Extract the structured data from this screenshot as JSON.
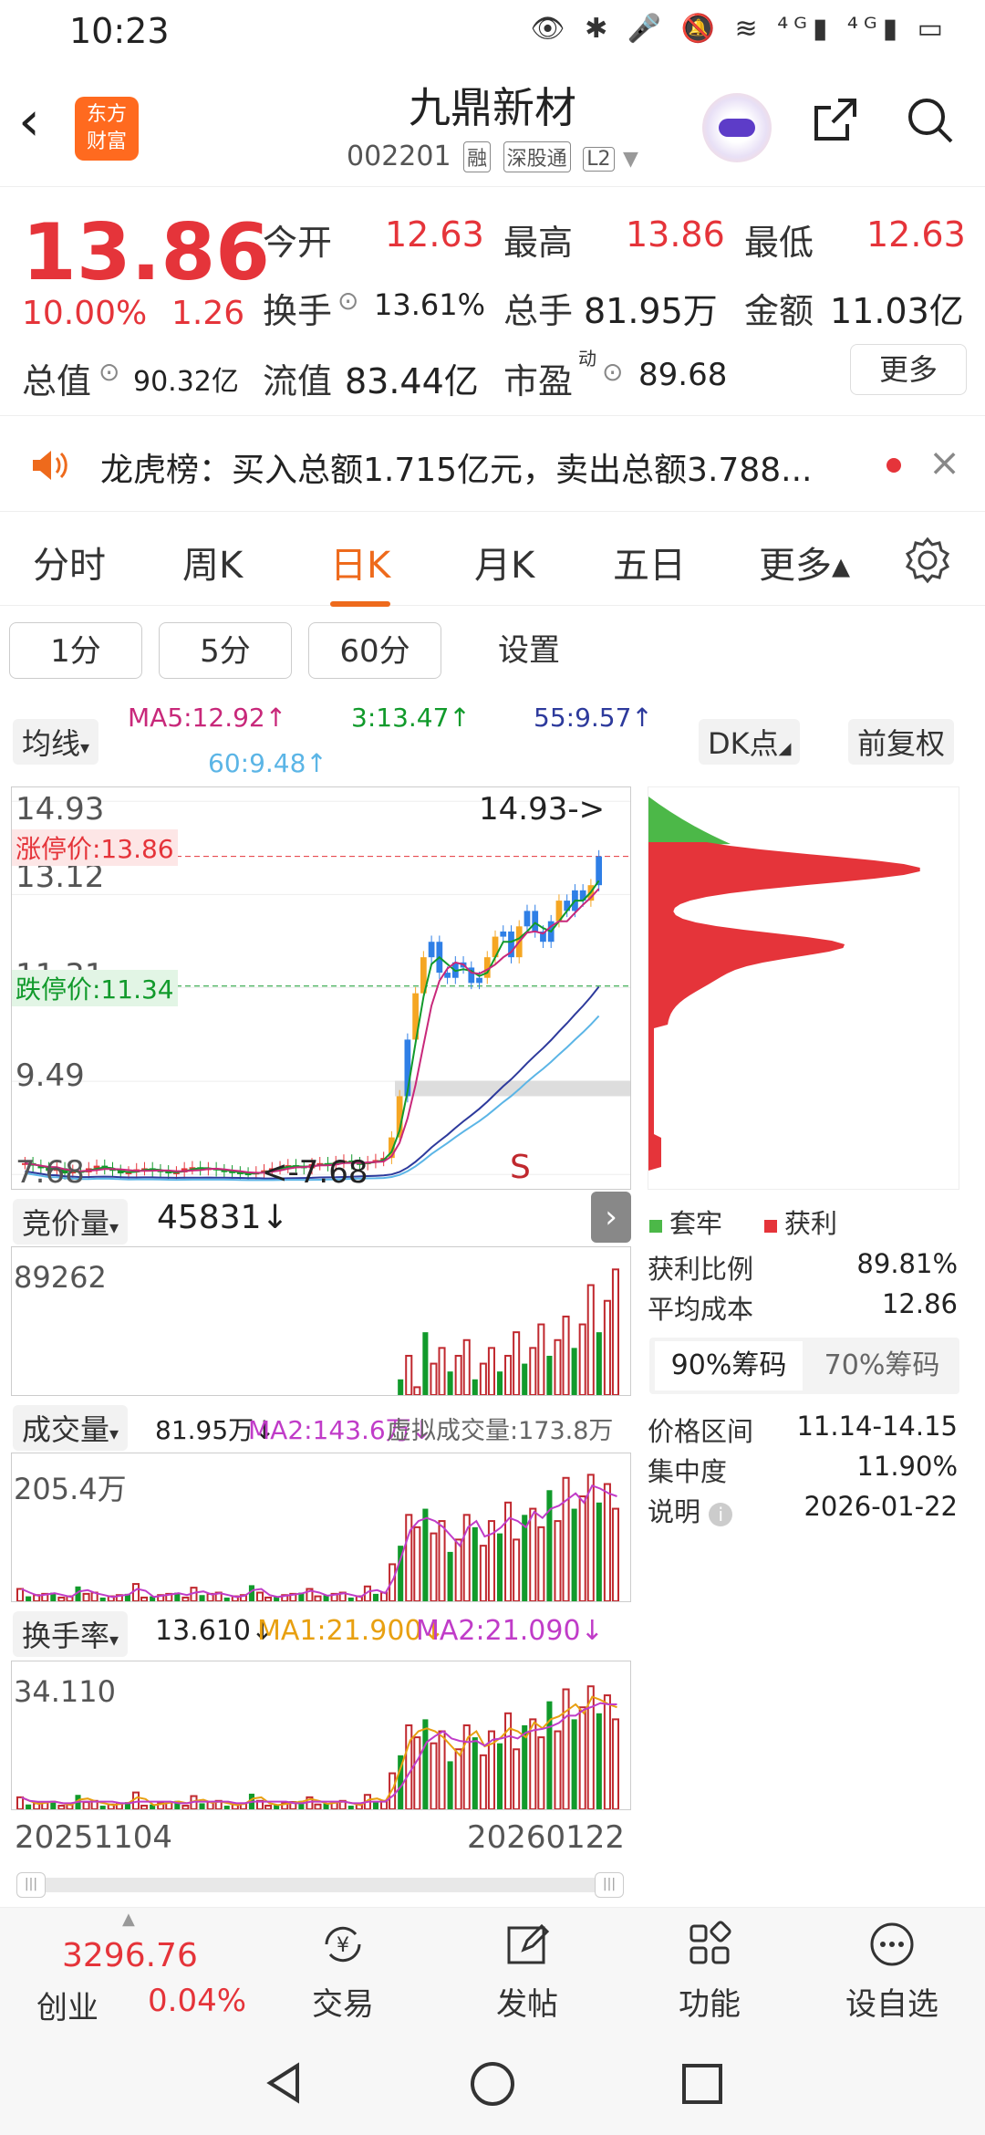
{
  "status_bar": {
    "time": "10:23",
    "icons": "👁 ✱ 🎤 🔕 ≋ ⁴ᴳ▮ ⁴ᴳ▮ ▭"
  },
  "header": {
    "logo_line1": "东方",
    "logo_line2": "财富",
    "stock_name": "九鼎新材",
    "stock_code": "002201",
    "tags": [
      "融",
      "深股通",
      "L2"
    ],
    "icons": [
      "back-icon",
      "avatar",
      "share-icon",
      "search-icon"
    ]
  },
  "quote": {
    "price": "13.86",
    "change_pct": "10.00%",
    "change_amt": "1.26",
    "open_label": "今开",
    "open": "12.63",
    "high_label": "最高",
    "high": "13.86",
    "low_label": "最低",
    "low": "12.63",
    "turnover_label": "换手",
    "turnover": "13.61%",
    "volume_label": "总手",
    "volume": "81.95万",
    "amount_label": "金额",
    "amount": "11.03亿",
    "mktcap_label": "总值",
    "mktcap": "90.32亿",
    "float_label": "流值",
    "float": "83.44亿",
    "pe_label": "市盈",
    "pe_sup": "动",
    "pe": "89.68",
    "more": "更多"
  },
  "notice": {
    "text": "龙虎榜：买入总额1.715亿元，卖出总额3.788..."
  },
  "tabs": [
    "分时",
    "周K",
    "日K",
    "月K",
    "五日",
    "更多▴"
  ],
  "active_tab": "日K",
  "periods": [
    "1分",
    "5分",
    "60分",
    "设置"
  ],
  "kline": {
    "ma_type": "均线",
    "ma5": "MA5:12.92↑",
    "ma3": "3:13.47↑",
    "ma55": "55:9.57↑",
    "ma60": "60:9.48↑",
    "dk": "DK点",
    "adjust": "前复权",
    "y_top": "14.93",
    "y_2": "13.12",
    "y_3": "11.31",
    "y_4": "9.49",
    "y_bottom": "7.68",
    "limit_up": "涨停价:13.86",
    "limit_down": "跌停价:11.34",
    "max_marker": "14.93->",
    "min_marker": "<-7.68",
    "s_marker": "S",
    "colors": {
      "up": "#e5343a",
      "down": "#119a2b",
      "ma5": "#c8287a",
      "ma3": "#119a2b",
      "ma55": "#2d3a9c",
      "ma60": "#5bb5e6",
      "yang": "#f5a623",
      "yin_blue": "#2f7fe6"
    }
  },
  "auction": {
    "label": "竞价量",
    "value": "45831↓",
    "y_top": "89262"
  },
  "volume_panel": {
    "label": "成交量",
    "value": "81.95万↓",
    "ma2": "MA2:143.6万↓",
    "virtual": "虚拟成交量:173.8万",
    "y_top": "205.4万"
  },
  "turnover_panel": {
    "label": "换手率",
    "value": "13.610↓",
    "ma1": "MA1:21.900↓",
    "ma2": "MA2:21.090↓",
    "y_top": "34.110"
  },
  "x_axis": {
    "start": "20251104",
    "end": "20260122"
  },
  "chips": {
    "legend_trapped": "套牢",
    "legend_profit": "获利",
    "profit_ratio_label": "获利比例",
    "profit_ratio": "89.81%",
    "avg_cost_label": "平均成本",
    "avg_cost": "12.86",
    "tab90": "90%筹码",
    "tab70": "70%筹码",
    "range_label": "价格区间",
    "range": "11.14-14.15",
    "concentration_label": "集中度",
    "concentration": "11.90%",
    "note_label": "说明",
    "date": "2026-01-22"
  },
  "bottom_nav": {
    "index_value": "3296.76",
    "index_name": "创业",
    "index_pct": "0.04%",
    "items": [
      {
        "label": "交易",
        "icon": "yen-cycle-icon"
      },
      {
        "label": "发帖",
        "icon": "edit-icon"
      },
      {
        "label": "功能",
        "icon": "grid-icon"
      },
      {
        "label": "设自选",
        "icon": "more-dots-icon"
      }
    ]
  }
}
